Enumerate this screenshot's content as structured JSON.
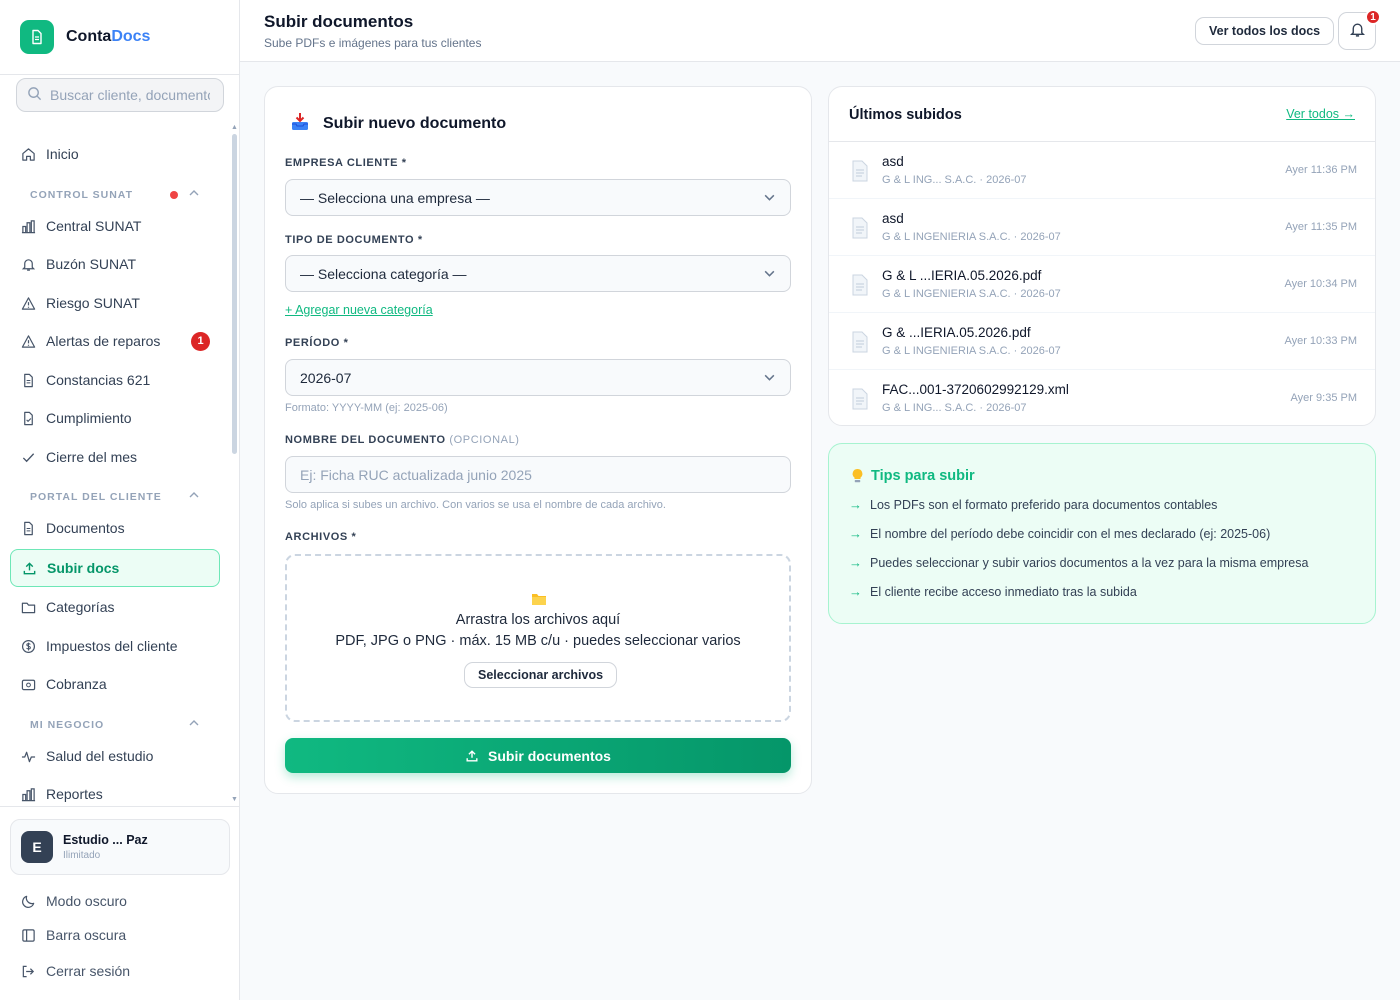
{
  "brand": {
    "name_a": "Conta",
    "name_b": "Docs"
  },
  "search": {
    "placeholder": "Buscar cliente, documento..."
  },
  "nav": {
    "inicio": "Inicio",
    "section_control": "CONTROL SUNAT",
    "central": "Central SUNAT",
    "buzon": "Buzón SUNAT",
    "riesgo": "Riesgo SUNAT",
    "alertas": "Alertas de reparos",
    "alertas_count": "1",
    "constancias": "Constancias 621",
    "cumplimiento": "Cumplimiento",
    "cierre": "Cierre del mes",
    "section_portal": "PORTAL DEL CLIENTE",
    "documentos": "Documentos",
    "subir": "Subir docs",
    "categorias": "Categorías",
    "impuestos": "Impuestos del cliente",
    "cobranza": "Cobranza",
    "section_negocio": "MI NEGOCIO",
    "salud": "Salud del estudio",
    "reportes": "Reportes"
  },
  "studio": {
    "initial": "E",
    "name": "Estudio ... Paz",
    "plan": "Ilimitado"
  },
  "bottom": {
    "dark_mode": "Modo oscuro",
    "dark_bar": "Barra oscura",
    "logout": "Cerrar sesión"
  },
  "header": {
    "title": "Subir documentos",
    "subtitle": "Sube PDFs e imágenes para tus clientes",
    "all_docs": "Ver todos los docs",
    "notif_count": "1"
  },
  "form": {
    "title": "Subir nuevo documento",
    "empresa_label": "EMPRESA CLIENTE *",
    "empresa_value": "— Selecciona una empresa —",
    "tipo_label": "TIPO DE DOCUMENTO *",
    "tipo_value": "— Selecciona categoría —",
    "add_category": "+ Agregar nueva categoría",
    "periodo_label": "PERÍODO *",
    "periodo_value": "2026-07",
    "periodo_hint": "Formato: YYYY-MM (ej: 2025-06)",
    "nombre_label": "NOMBRE DEL DOCUMENTO",
    "nombre_optional": "(OPCIONAL)",
    "nombre_placeholder": "Ej: Ficha RUC actualizada junio 2025",
    "nombre_hint": "Solo aplica si subes un archivo. Con varios se usa el nombre de cada archivo.",
    "archivos_label": "ARCHIVOS *",
    "drop_line1": "Arrastra los archivos aquí",
    "drop_line2": "PDF, JPG o PNG · máx. 15 MB c/u · puedes seleccionar varios",
    "select_files": "Seleccionar archivos",
    "submit": "Subir documentos"
  },
  "recent": {
    "title": "Últimos subidos",
    "see_all": "Ver todos →",
    "items": [
      {
        "name": "asd",
        "meta": "G & L ING... S.A.C. · 2026-07",
        "time": "Ayer 11:36 PM"
      },
      {
        "name": "asd",
        "meta": "G & L INGENIERIA S.A.C. · 2026-07",
        "time": "Ayer 11:35 PM"
      },
      {
        "name": "G & L ...IERIA.05.2026.pdf",
        "meta": "G & L INGENIERIA S.A.C. · 2026-07",
        "time": "Ayer 10:34 PM"
      },
      {
        "name": "G & ...IERIA.05.2026.pdf",
        "meta": "G & L INGENIERIA S.A.C. · 2026-07",
        "time": "Ayer 10:33 PM"
      },
      {
        "name": "FAC...001-3720602992129.xml",
        "meta": "G & L ING... S.A.C. · 2026-07",
        "time": "Ayer 9:35 PM"
      }
    ]
  },
  "tips": {
    "title": "Tips para subir",
    "items": [
      "Los PDFs son el formato preferido para documentos contables",
      "El nombre del período debe coincidir con el mes declarado (ej: 2025-06)",
      "Puedes seleccionar y subir varios documentos a la vez para la misma empresa",
      "El cliente recibe acceso inmediato tras la subida"
    ]
  },
  "colors": {
    "accent": "#10b981",
    "accent_dark": "#059669",
    "badge": "#dc2626",
    "link_blue": "#3b82f6"
  }
}
